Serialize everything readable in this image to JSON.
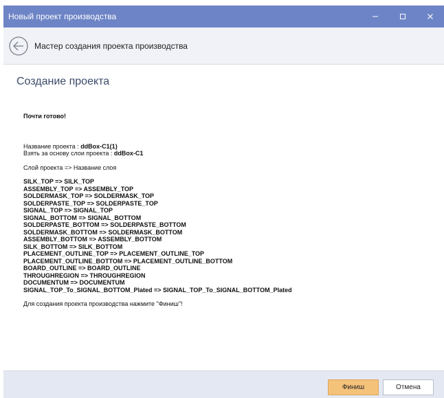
{
  "window": {
    "title": "Новый проект производства"
  },
  "wizard": {
    "header": "Мастер создания проекта производства"
  },
  "page": {
    "title": "Создание проекта"
  },
  "summary": {
    "ready": "Почти готово!",
    "project_name_label": "Название проекта : ",
    "project_name_value": "ddBox-C1(1)",
    "base_layers_label": "Взять за основу слои проекта : ",
    "base_layers_value": "ddBox-C1",
    "mapping_header": "Слой проекта => Название слоя",
    "layers": [
      "SILK_TOP => SILK_TOP",
      "ASSEMBLY_TOP => ASSEMBLY_TOP",
      "SOLDERMASK_TOP => SOLDERMASK_TOP",
      "SOLDERPASTE_TOP => SOLDERPASTE_TOP",
      "SIGNAL_TOP => SIGNAL_TOP",
      "SIGNAL_BOTTOM => SIGNAL_BOTTOM",
      "SOLDERPASTE_BOTTOM => SOLDERPASTE_BOTTOM",
      "SOLDERMASK_BOTTOM => SOLDERMASK_BOTTOM",
      "ASSEMBLY_BOTTOM => ASSEMBLY_BOTTOM",
      "SILK_BOTTOM => SILK_BOTTOM",
      "PLACEMENT_OUTLINE_TOP => PLACEMENT_OUTLINE_TOP",
      "PLACEMENT_OUTLINE_BOTTOM => PLACEMENT_OUTLINE_BOTTOM",
      "BOARD_OUTLINE => BOARD_OUTLINE",
      "THROUGHREGION => THROUGHREGION",
      "DOCUMENTUM => DOCUMENTUM",
      "SIGNAL_TOP_To_SIGNAL_BOTTOM_Plated => SIGNAL_TOP_To_SIGNAL_BOTTOM_Plated"
    ],
    "footer_note": "Для создания проекта производства нажмите \"Финиш\"!"
  },
  "buttons": {
    "finish": "Финиш",
    "cancel": "Отмена"
  },
  "colors": {
    "titlebar": "#6d84c6",
    "header_bg": "#f0f2f7",
    "footer_bg": "#e4e8f3",
    "finish_button": "#f5c27a",
    "title_text": "#3b4a6b"
  },
  "icons": {
    "minimize": "minimize-icon",
    "maximize": "maximize-icon",
    "close": "close-icon",
    "back": "back-arrow-icon"
  }
}
